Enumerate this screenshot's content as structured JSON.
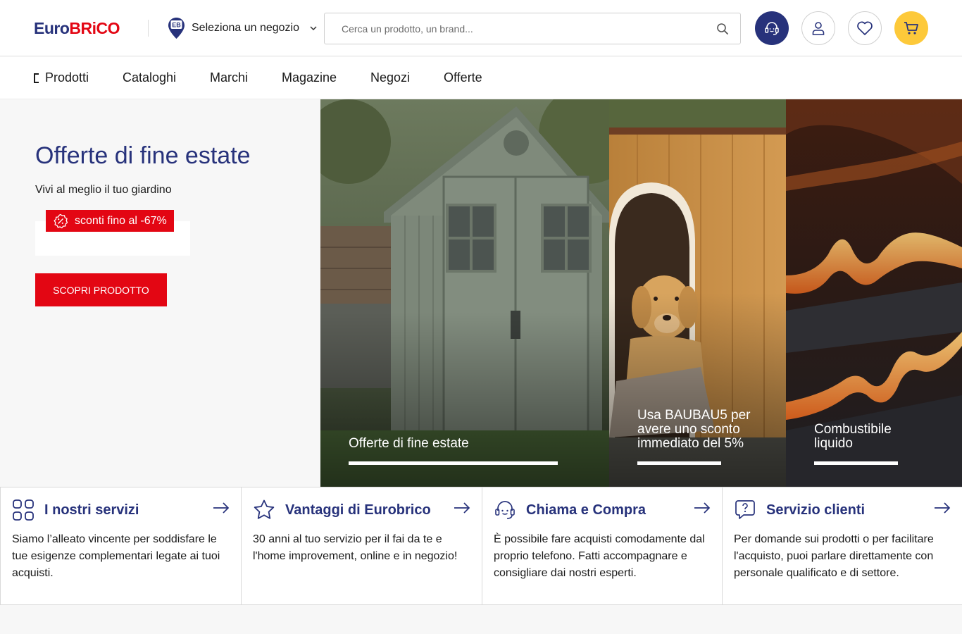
{
  "header": {
    "logo": {
      "part1": "Euro",
      "part2": "BRiCO"
    },
    "store_selector": {
      "label": "Seleziona un negozio",
      "pin_text": "EB"
    },
    "search": {
      "placeholder": "Cerca un prodotto, un brand..."
    },
    "icons": [
      "headset-icon",
      "user-icon",
      "heart-icon",
      "cart-icon"
    ]
  },
  "nav": {
    "items": [
      "Prodotti",
      "Cataloghi",
      "Marchi",
      "Magazine",
      "Negozi",
      "Offerte"
    ]
  },
  "hero": {
    "title": "Offerte di fine estate",
    "subtitle": "Vivi al meglio il tuo giardino",
    "badge": "sconti fino al -67%",
    "cta": "SCOPRI PRODOTTO"
  },
  "panels": [
    {
      "label": "Offerte di fine estate"
    },
    {
      "label": "Usa BAUBAU5 per avere uno sconto immediato del 5%"
    },
    {
      "label": "Combustibile liquido"
    }
  ],
  "services": [
    {
      "title": "I nostri servizi",
      "desc": "Siamo l’alleato vincente per soddisfare le tue esigenze complementari legate ai tuoi acquisti.",
      "icon": "grid-icon"
    },
    {
      "title": "Vantaggi di Eurobrico",
      "desc": "30 anni al tuo servizio per il fai da te e l'home improvement, online e in negozio!",
      "icon": "star-icon"
    },
    {
      "title": "Chiama e Compra",
      "desc": "È possibile fare acquisti comodamente dal proprio telefono. Fatti accompagnare e consigliare dai nostri esperti.",
      "icon": "headset-icon"
    },
    {
      "title": "Servizio clienti",
      "desc": "Per domande sui prodotti o per facilitare l'acquisto, puoi parlare direttamente con personale qualificato e di settore.",
      "icon": "question-bubble-icon"
    }
  ],
  "colors": {
    "brand_blue": "#27327b",
    "brand_red": "#e30613",
    "cart_yellow": "#fdc93a"
  }
}
